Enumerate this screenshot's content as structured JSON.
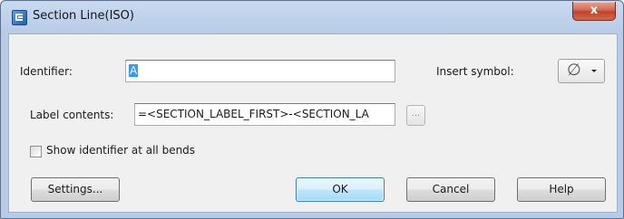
{
  "window": {
    "title": "Section Line(ISO)",
    "close_label": "x"
  },
  "identifier": {
    "label": "Identifier:",
    "value": "A"
  },
  "insert_symbol": {
    "label": "Insert symbol:",
    "symbol": "∅"
  },
  "label_contents": {
    "label": "Label contents:",
    "value": "=<SECTION_LABEL_FIRST>-<SECTION_LA",
    "browse_label": "..."
  },
  "show_identifier": {
    "label": "Show identifier at all bends",
    "checked": false
  },
  "buttons": {
    "settings": "Settings...",
    "ok": "OK",
    "cancel": "Cancel",
    "help": "Help"
  },
  "colors": {
    "title_bar": "#b7cbe6",
    "close_button": "#c3412a",
    "selection": "#3399ff",
    "default_button": "#bee6fd"
  }
}
